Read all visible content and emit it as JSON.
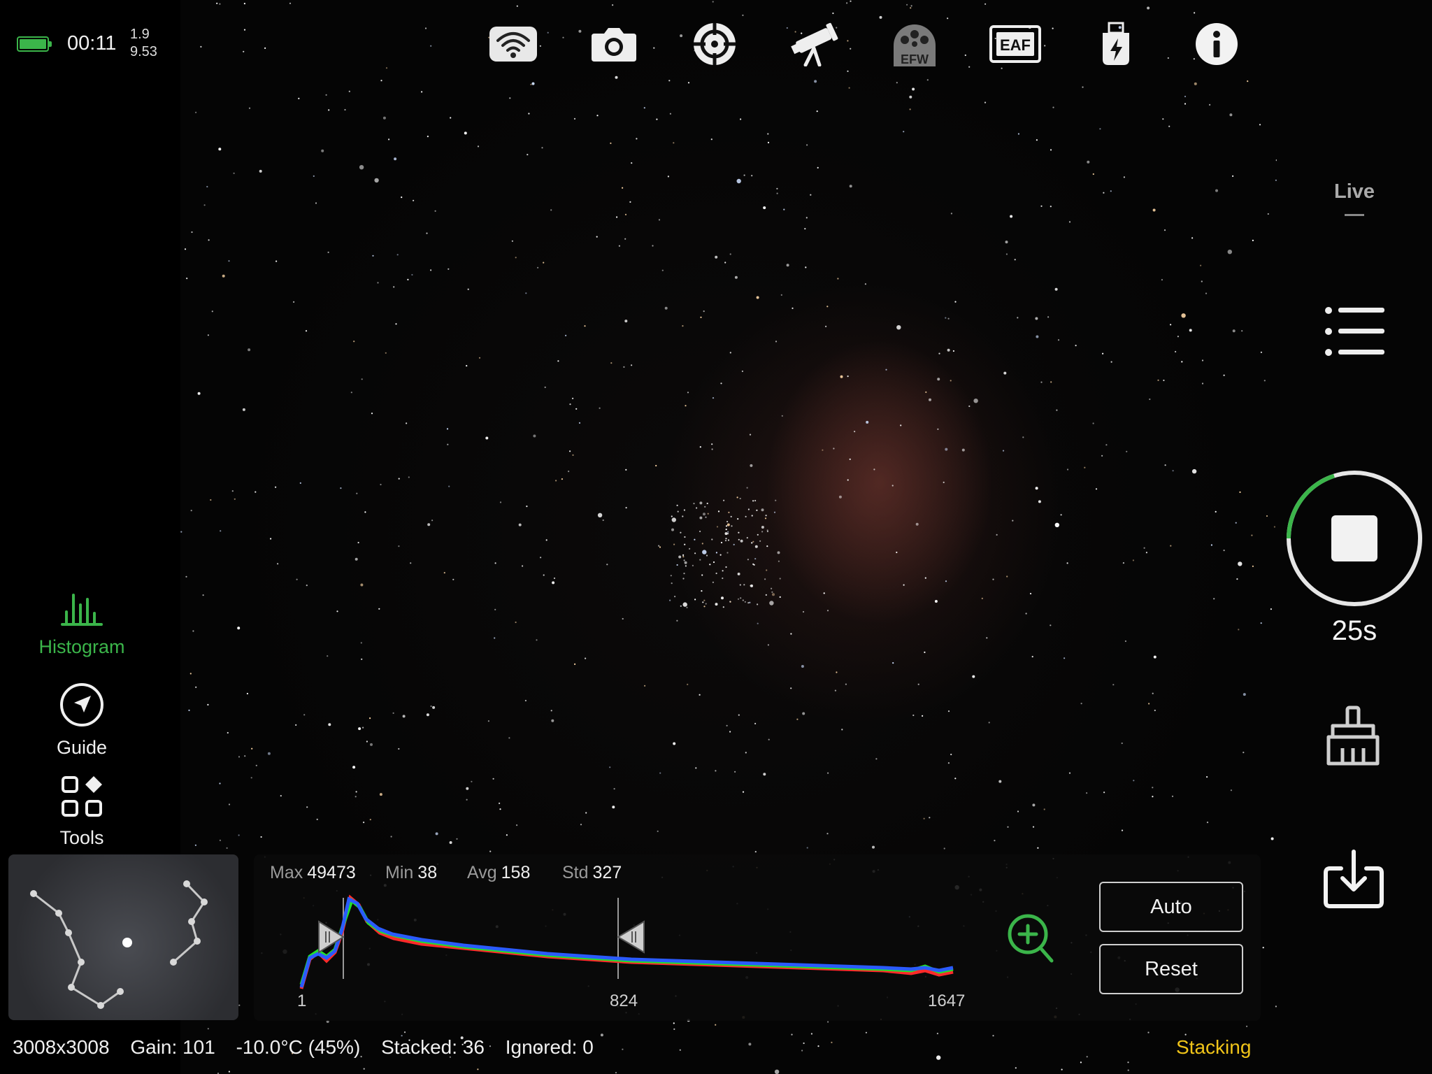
{
  "status": {
    "battery_level": 1.0,
    "time": "00:11",
    "version_top": "1.9",
    "version_bottom": "9.53"
  },
  "top_toolbar": {
    "icons": [
      "wifi-icon",
      "camera-icon",
      "guide-crosshair-icon",
      "telescope-icon",
      "efw-icon",
      "eaf-icon",
      "usb-power-icon",
      "info-icon"
    ],
    "efw_label": "EFW",
    "eaf_label": "EAF"
  },
  "left_tools": {
    "histogram_label": "Histogram",
    "guide_label": "Guide",
    "tools_label": "Tools"
  },
  "right_panel": {
    "mode_label": "Live",
    "exposure_label": "25s",
    "capture_progress": 0.2
  },
  "histogram": {
    "max_label": "Max",
    "max_value": "49473",
    "min_label": "Min",
    "min_value": "38",
    "avg_label": "Avg",
    "avg_value": "158",
    "std_label": "Std",
    "std_value": "327",
    "axis_ticks": [
      "1",
      "824",
      "1647"
    ],
    "auto_label": "Auto",
    "reset_label": "Reset"
  },
  "status_bar": {
    "resolution": "3008x3008",
    "gain": "Gain: 101",
    "temperature": "-10.0°C (45%)",
    "stacked": "Stacked: 36",
    "ignored": "Ignored: 0",
    "state": "Stacking"
  },
  "colors": {
    "accent_green": "#3bb54a",
    "stacking_yellow": "#f0c419"
  }
}
